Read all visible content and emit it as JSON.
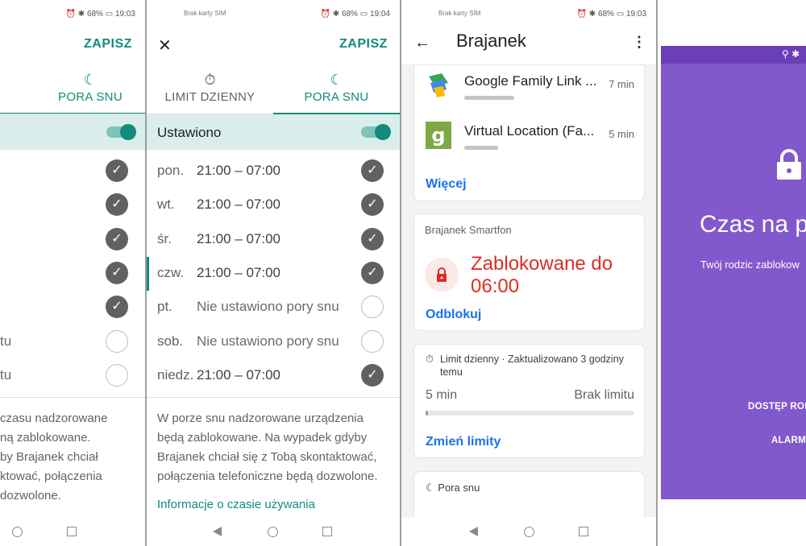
{
  "screen1": {
    "status_time": "19:03",
    "status_battery": "68%",
    "save_label": "ZAPISZ",
    "tab_sleep": "PORA SNU",
    "rows": [
      {
        "checked": true
      },
      {
        "checked": true
      },
      {
        "checked": true
      },
      {
        "checked": true
      },
      {
        "checked": true
      },
      {
        "text": "tu",
        "checked": false
      },
      {
        "text": "tu",
        "checked": false
      }
    ],
    "note_lines": [
      "czasu nadzorowane",
      "ną zablokowane.",
      "by Brajanek chciał",
      "ktować, połączenia",
      "dozwolone."
    ]
  },
  "screen2": {
    "status_carrier": "Brak karty SIM",
    "status_time": "19:04",
    "status_battery": "68%",
    "save_label": "ZAPISZ",
    "tab_daily": "LIMIT DZIENNY",
    "tab_sleep": "PORA SNU",
    "set_label": "Ustawiono",
    "days": [
      {
        "day": "pon.",
        "time": "21:00 – 07:00",
        "checked": true
      },
      {
        "day": "wt.",
        "time": "21:00 – 07:00",
        "checked": true
      },
      {
        "day": "śr.",
        "time": "21:00 – 07:00",
        "checked": true
      },
      {
        "day": "czw.",
        "time": "21:00 – 07:00",
        "checked": true
      },
      {
        "day": "pt.",
        "time": "Nie ustawiono pory snu",
        "checked": false
      },
      {
        "day": "sob.",
        "time": "Nie ustawiono pory snu",
        "checked": false
      },
      {
        "day": "niedz.",
        "time": "21:00 – 07:00",
        "checked": true
      }
    ],
    "note_lines": [
      "W porze snu nadzorowane urządzenia",
      "będą zablokowane. Na wypadek gdyby",
      "Brajanek chciał się z Tobą skontaktować,",
      "połączenia telefoniczne będą dozwolone."
    ],
    "info_link": "Informacje o czasie używania"
  },
  "screen3": {
    "status_carrier": "Brak karty SIM",
    "status_time": "19:03",
    "status_battery": "68%",
    "title": "Brajanek",
    "apps": [
      {
        "name": "Google Family Link ...",
        "time": "7 min",
        "icon": "family-link-icon"
      },
      {
        "name": "Virtual Location (Fa...",
        "time": "5 min",
        "icon": "virtual-location-icon"
      }
    ],
    "more_link": "Więcej",
    "device_name": "Brajanek Smartfon",
    "blocked_lines": [
      "Zablokowane do",
      "06:00"
    ],
    "unlock_link": "Odblokuj",
    "limit_header": "Limit dzienny · Zaktualizowano 3 godziny temu",
    "limit_used": "5 min",
    "limit_value": "Brak limitu",
    "limit_progress": 0.01,
    "change_limits": "Zmień limity",
    "sleep_header": "Pora snu"
  },
  "screen4": {
    "bg_color": "#8259cc",
    "title_partial": "Czas na p",
    "subtitle_partial": "Twój rodzic zablokow",
    "btn_access_partial": "DOSTĘP ROD",
    "btn_alarm_partial": "ALARM"
  },
  "colors": {
    "accent": "#128a7c",
    "link": "#1a73e8",
    "danger": "#d93025"
  }
}
